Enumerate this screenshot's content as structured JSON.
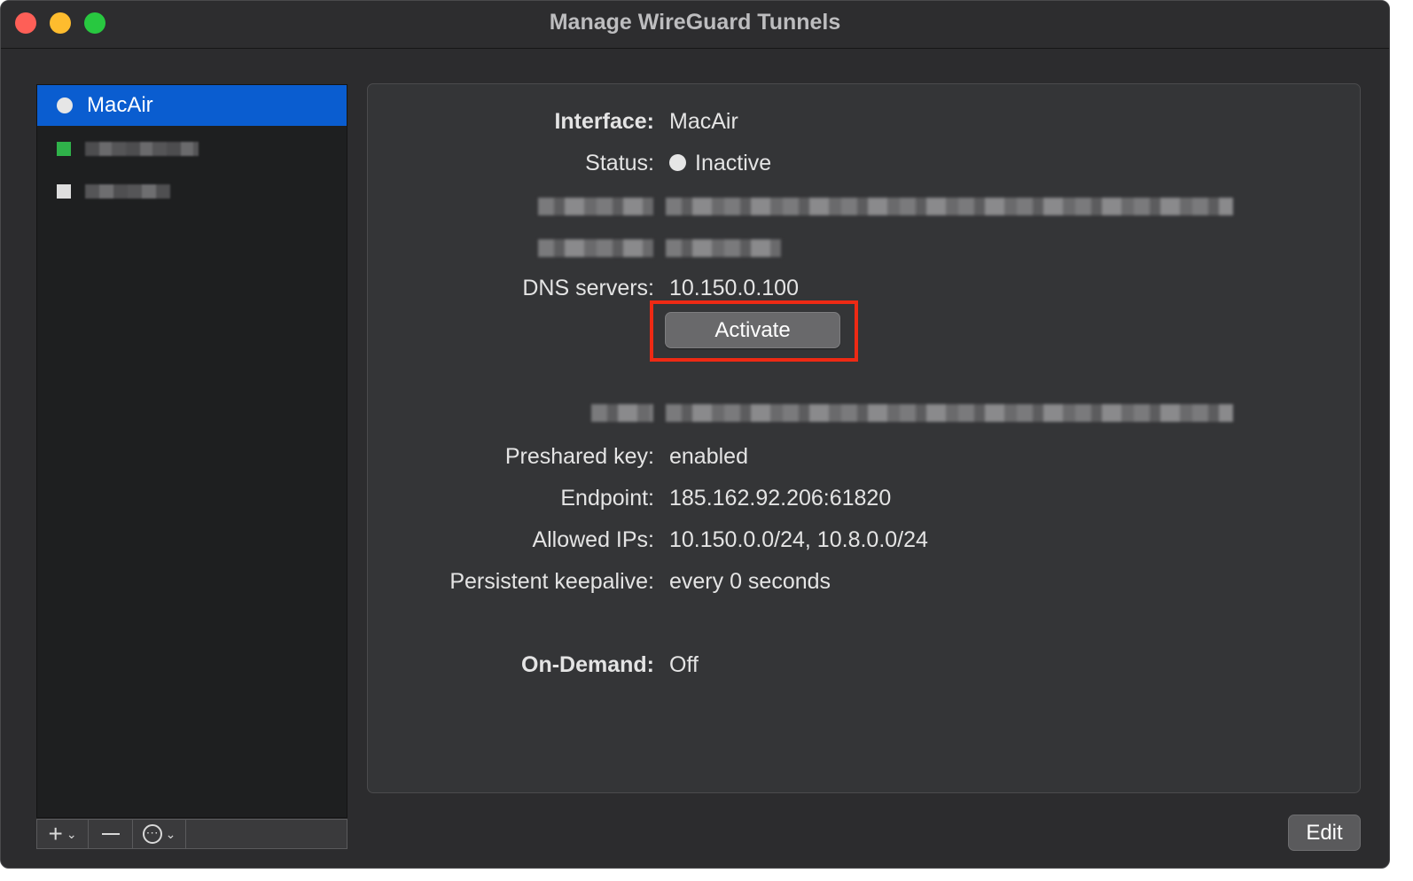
{
  "window": {
    "title": "Manage WireGuard Tunnels"
  },
  "sidebar": {
    "tunnels": [
      {
        "name": "MacAir",
        "status": "inactive",
        "selected": true
      }
    ],
    "toolbar": {
      "add_label": "+",
      "remove_label": "—",
      "more_label": "⋯"
    }
  },
  "details": {
    "interface_label": "Interface:",
    "interface_value": "MacAir",
    "status_label": "Status:",
    "status_value": "Inactive",
    "dns_label": "DNS servers:",
    "dns_value": "10.150.0.100",
    "activate_label": "Activate",
    "preshared_label": "Preshared key:",
    "preshared_value": "enabled",
    "endpoint_label": "Endpoint:",
    "endpoint_value": "185.162.92.206:61820",
    "allowed_label": "Allowed IPs:",
    "allowed_value": "10.150.0.0/24, 10.8.0.0/24",
    "keepalive_label": "Persistent keepalive:",
    "keepalive_value": "every 0 seconds",
    "ondemand_label": "On-Demand:",
    "ondemand_value": "Off"
  },
  "footer": {
    "edit_label": "Edit"
  },
  "colors": {
    "selection": "#0a5dd0",
    "highlight_box": "#ee2a14",
    "active_green": "#2fb24a"
  }
}
